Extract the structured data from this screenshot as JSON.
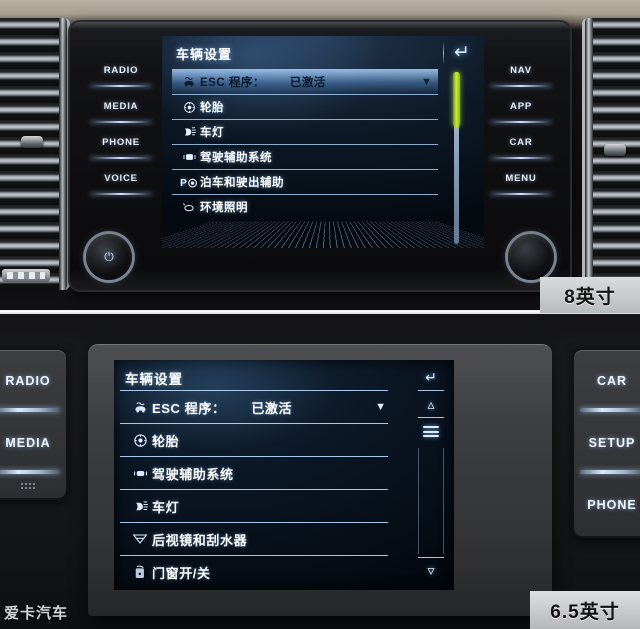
{
  "top_unit": {
    "size_badge": "8英寸",
    "screen": {
      "title": "车辆设置",
      "back_icon": "back-arrow-icon",
      "scrollbar_color": "#c8ef3a",
      "items": [
        {
          "icon": "esc-stability-icon",
          "label": "ESC 程序：",
          "value": "已激活",
          "caret": "▼",
          "selected": true
        },
        {
          "icon": "tire-icon",
          "label": "轮胎",
          "value": "",
          "caret": "",
          "selected": false
        },
        {
          "icon": "headlight-icon",
          "label": "车灯",
          "value": "",
          "caret": "",
          "selected": false
        },
        {
          "icon": "driver-assist-icon",
          "label": "驾驶辅助系统",
          "value": "",
          "caret": "",
          "selected": false
        },
        {
          "icon": "park-assist-icon",
          "label": "泊车和驶出辅助",
          "value": "",
          "caret": "",
          "selected": false
        },
        {
          "icon": "ambient-light-icon",
          "label": "环境照明",
          "value": "",
          "caret": "",
          "selected": false
        }
      ]
    },
    "left_buttons": [
      "RADIO",
      "MEDIA",
      "PHONE",
      "VOICE"
    ],
    "right_buttons": [
      "NAV",
      "APP",
      "CAR",
      "MENU"
    ],
    "left_knob_icon": "power-volume-icon",
    "right_knob_icon": "tuning-knob-icon"
  },
  "bottom_unit": {
    "size_badge": "6.5英寸",
    "screen": {
      "title": "车辆设置",
      "items": [
        {
          "icon": "esc-stability-icon",
          "label": "ESC 程序：",
          "value": "已激活",
          "caret": "▼"
        },
        {
          "icon": "tire-icon",
          "label": "轮胎",
          "value": "",
          "caret": ""
        },
        {
          "icon": "driver-assist-icon",
          "label": "驾驶辅助系统",
          "value": "",
          "caret": ""
        },
        {
          "icon": "headlight-icon",
          "label": "车灯",
          "value": "",
          "caret": ""
        },
        {
          "icon": "wiper-mirror-icon",
          "label": "后视镜和刮水器",
          "value": "",
          "caret": ""
        },
        {
          "icon": "door-window-icon",
          "label": "门窗开/关",
          "value": "",
          "caret": ""
        }
      ],
      "controls": [
        {
          "icon": "back-arrow-icon",
          "label": "↱"
        },
        {
          "icon": "chevron-up-icon",
          "label": "⌃"
        },
        {
          "icon": "menu-list-icon",
          "label": ""
        },
        {
          "icon": "chevron-down-icon",
          "label": "⌄"
        }
      ]
    },
    "left_buttons": [
      "RADIO",
      "MEDIA"
    ],
    "right_buttons": [
      "CAR",
      "SETUP",
      "PHONE"
    ]
  },
  "watermark": "爱卡汽车"
}
